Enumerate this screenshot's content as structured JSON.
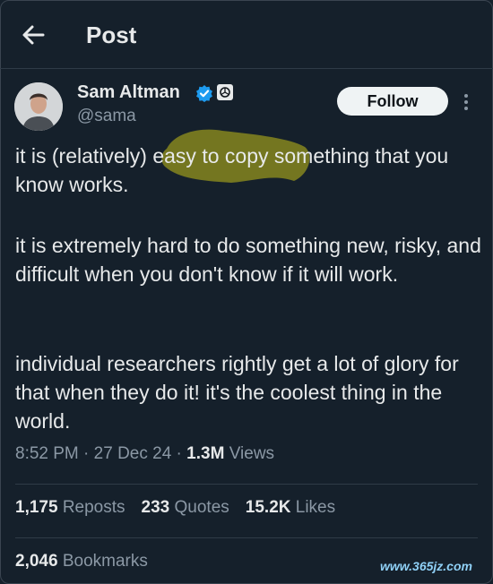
{
  "header": {
    "title": "Post",
    "back_icon": "arrow-left-icon"
  },
  "author": {
    "name": "Sam Altman",
    "handle": "@sama",
    "verified_icon": "verified-badge-icon",
    "affiliation_icon": "openai-logo-icon"
  },
  "actions": {
    "follow_label": "Follow",
    "more_icon": "more-vertical-icon"
  },
  "post": {
    "paragraphs": [
      "it is (relatively) easy to copy something that you know works.",
      "it is extremely hard to do something new, risky, and difficult when you don't know if it will work.",
      "individual researchers rightly get a lot of glory for that when they do it! it's the coolest thing in the world."
    ],
    "highlight_color": "#8a8a1e"
  },
  "meta": {
    "time": "8:52 PM",
    "date": "27 Dec 24",
    "views_count": "1.3M",
    "views_label": "Views"
  },
  "stats": {
    "reposts_count": "1,175",
    "reposts_label": "Reposts",
    "quotes_count": "233",
    "quotes_label": "Quotes",
    "likes_count": "15.2K",
    "likes_label": "Likes",
    "bookmarks_count": "2,046",
    "bookmarks_label": "Bookmarks"
  },
  "watermark": "www.365jz.com",
  "colors": {
    "background": "#15202b",
    "text": "#e7e9ea",
    "secondary": "#8b98a5",
    "verified": "#1d9bf0"
  }
}
